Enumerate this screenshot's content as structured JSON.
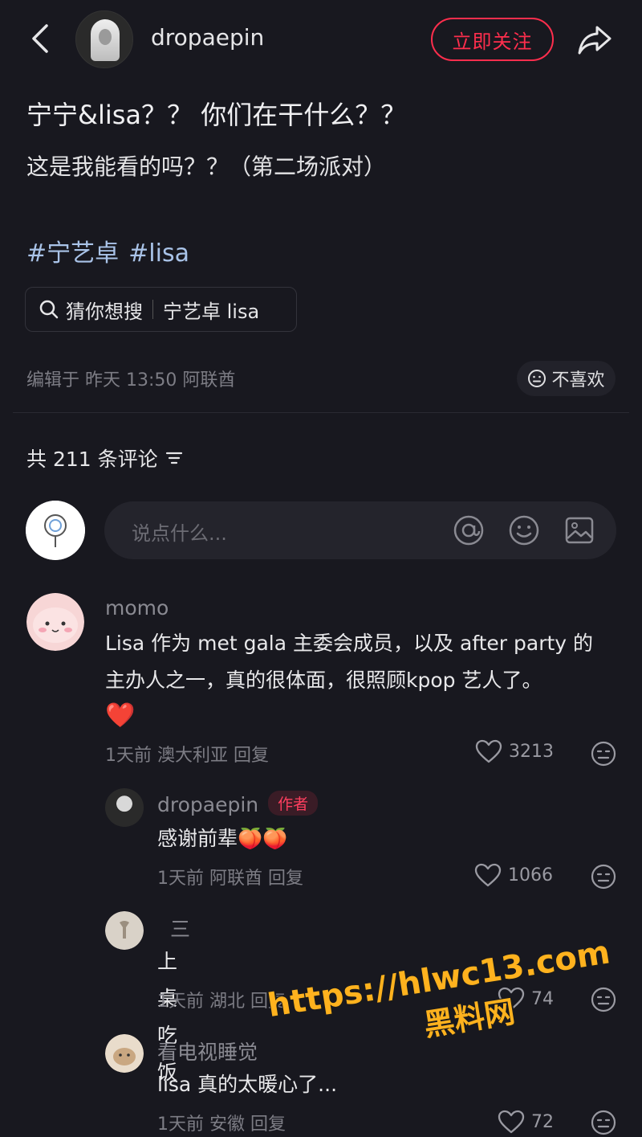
{
  "header": {
    "username": "dropaepin",
    "follow_label": "立即关注"
  },
  "post": {
    "title": "宁宁&lisa？？ 你们在干什么？？",
    "subtitle": "这是我能看的吗？？（第二场派对）",
    "tags": [
      "#宁艺卓",
      "#lisa"
    ],
    "guess_label": "猜你想搜",
    "guess_query": "宁艺卓 lisa",
    "meta": "编辑于 昨天 13:50 阿联酋",
    "dislike_label": "不喜欢"
  },
  "comments_header": {
    "count_text": "共 211 条评论"
  },
  "comment_input": {
    "placeholder": "说点什么..."
  },
  "comments": [
    {
      "name": "momo",
      "text_line1": "Lisa 作为 met gala 主委会成员，以及 after party 的",
      "text_line2": "主办人之一，真的很体面，很照顾kpop 艺人了。",
      "emoji": "❤️",
      "meta": "1天前 澳大利亚 回复",
      "likes": "3213"
    },
    {
      "name": "dropaepin",
      "badge": "作者",
      "text": "感谢前辈",
      "emoji": "🍑🍑",
      "meta": "1天前 阿联酋 回复",
      "likes": "1066"
    },
    {
      "name": "三",
      "text": "上桌吃饭",
      "meta": "1天前 湖北 回复",
      "likes": "74"
    },
    {
      "name": "看电视睡觉",
      "text": "lisa 真的太暖心了...",
      "meta": "1天前 安徽 回复",
      "likes": "72"
    }
  ],
  "watermark": {
    "url": "https://hlwc13.com",
    "name": "黑料网"
  },
  "colors": {
    "background": "#18181f",
    "accent_red": "#ff2e4d",
    "tag_blue": "#a9c3e8",
    "watermark_orange": "#ffb21e"
  }
}
